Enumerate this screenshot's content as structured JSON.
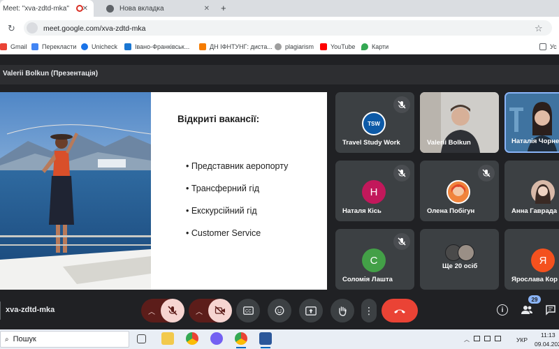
{
  "browser": {
    "tabs": [
      {
        "title": "Meet: \"xva-zdtd-mka\"",
        "active": true
      },
      {
        "title": "Нова вкладка",
        "active": false
      }
    ],
    "new_tab_glyph": "+",
    "url": "meet.google.com/xva-zdtd-mka",
    "bookmarks": [
      {
        "label": "Gmail",
        "icon": "gmail-icon",
        "color": "#ea4335"
      },
      {
        "label": "Перекласти",
        "icon": "translate-icon",
        "color": "#4285f4"
      },
      {
        "label": "Unicheck",
        "icon": "unicheck-icon",
        "color": "#1a73e8"
      },
      {
        "label": "Івано-Франківськ...",
        "icon": "document-icon",
        "color": "#1976d2"
      },
      {
        "label": "ДН ІФНТУНГ: диста...",
        "icon": "university-icon",
        "color": "#f57c00"
      },
      {
        "label": "plagiarism",
        "icon": "plagiarism-icon",
        "color": "#9e9e9e"
      },
      {
        "label": "YouTube",
        "icon": "youtube-icon",
        "color": "#ff0000"
      },
      {
        "label": "Карти",
        "icon": "maps-icon",
        "color": "#34a853"
      }
    ],
    "other_bookmarks_label": "Ус"
  },
  "meet": {
    "presenter_title": "Valerii Bolkun (Презентація)",
    "slide": {
      "heading": "Відкриті вакансії:",
      "bullets": [
        "• Представник аеропорту",
        "• Трансферний гід",
        "• Екскурсійний гід",
        "• Customer Service"
      ]
    },
    "participants": [
      {
        "name": "Travel Study Work",
        "avatar_text": "TSW",
        "avatar_color": "#0d5aa7",
        "muted": true,
        "kind": "logo"
      },
      {
        "name": "Valerii Bolkun",
        "muted": false,
        "kind": "video"
      },
      {
        "name": "Наталія Чорне",
        "muted": false,
        "kind": "video-active"
      },
      {
        "name": "Наталя Кісь",
        "avatar_text": "Н",
        "avatar_color": "#c2185b",
        "muted": true,
        "kind": "letter"
      },
      {
        "name": "Олена Побігун",
        "muted": true,
        "kind": "photo",
        "avatar_color": "#f0843c"
      },
      {
        "name": "Анна Гаврада",
        "muted": false,
        "kind": "photo",
        "avatar_color": "#d8b9a8"
      },
      {
        "name": "Соломія Лашта",
        "avatar_text": "С",
        "avatar_color": "#43a047",
        "muted": true,
        "kind": "letter"
      },
      {
        "name": "Ще 20 осіб",
        "muted": false,
        "kind": "group"
      },
      {
        "name": "Ярослава Кор",
        "avatar_text": "Я",
        "avatar_color": "#f4511e",
        "muted": false,
        "kind": "letter"
      }
    ],
    "meeting_code": "xva-zdtd-mka",
    "participant_count": "29",
    "colors": {
      "end_call": "#ea4335",
      "active_border": "#8ab4f8"
    }
  },
  "taskbar": {
    "search_label": "Пошук",
    "language": "УКР",
    "time": "11:13",
    "date": "09.04.202"
  }
}
